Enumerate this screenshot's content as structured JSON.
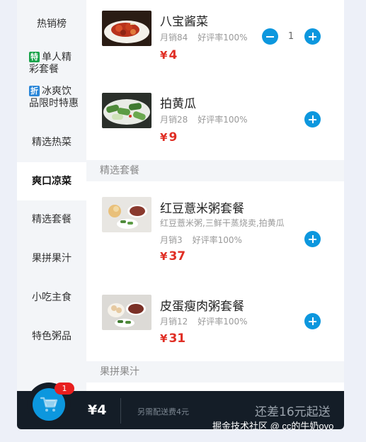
{
  "sidebar": {
    "items": [
      {
        "label": "热销榜"
      },
      {
        "label": "单人精彩套餐",
        "badge": "特",
        "badge_color": "#1aa34a"
      },
      {
        "label": "冰爽饮品限时特惠",
        "badge": "折",
        "badge_color": "#2a86d8"
      },
      {
        "label": "精选热菜"
      },
      {
        "label": "爽口凉菜",
        "active": true
      },
      {
        "label": "精选套餐"
      },
      {
        "label": "果拼果汁"
      },
      {
        "label": "小吃主食"
      },
      {
        "label": "特色粥品"
      }
    ]
  },
  "sections": [
    {
      "title": "精选套餐"
    },
    {
      "title": "果拼果汁"
    }
  ],
  "dishes": [
    {
      "name": "八宝酱菜",
      "sales": "月销84",
      "rating": "好评率100%",
      "price": "4",
      "quantity": "1"
    },
    {
      "name": "拍黄瓜",
      "sales": "月销28",
      "rating": "好评率100%",
      "price": "9"
    },
    {
      "name": "红豆薏米粥套餐",
      "desc": "红豆薏米粥,三鲜干蒸烧卖,拍黄瓜",
      "sales": "月销3",
      "rating": "好评率100%",
      "price": "37"
    },
    {
      "name": "皮蛋瘦肉粥套餐",
      "sales": "月销12",
      "rating": "好评率100%",
      "price": "31"
    }
  ],
  "currency": "¥",
  "cart": {
    "count": "1",
    "total": "¥4",
    "delivery": "另需配送费4元",
    "minimum": "还差16元起送"
  },
  "watermark": "掘金技术社区 @ cc的牛奶ovo",
  "colors": {
    "accent": "#0c97de",
    "price": "#e02e24",
    "cart_bg": "#141d27",
    "badge_red": "#e81e1e"
  },
  "icons": {
    "add": "plus-icon",
    "remove": "minus-icon",
    "cart": "shopping-cart-icon"
  }
}
